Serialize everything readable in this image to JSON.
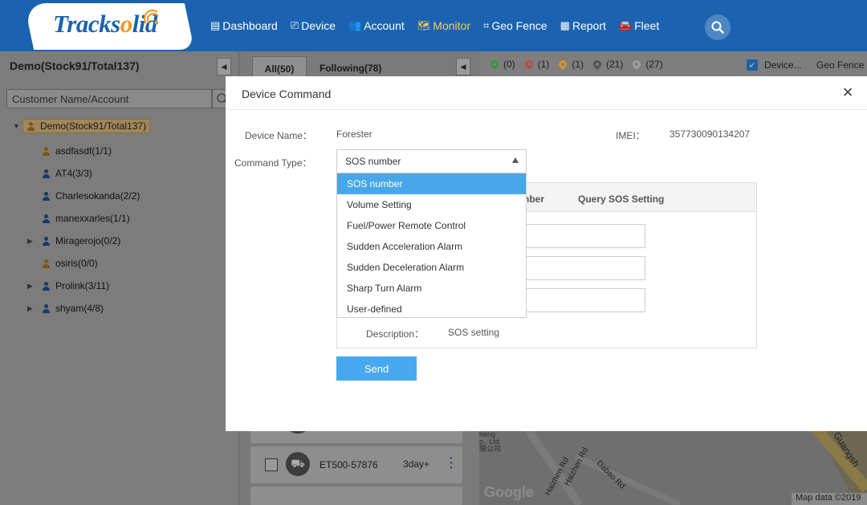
{
  "header": {
    "logo": "Tracksolid",
    "nav": [
      {
        "label": "Dashboard",
        "icon": "dashboard-icon",
        "glyph": "▤"
      },
      {
        "label": "Device",
        "icon": "device-icon",
        "glyph": "⎚"
      },
      {
        "label": "Account",
        "icon": "account-icon",
        "glyph": "👥"
      },
      {
        "label": "Monitor",
        "icon": "monitor-map-icon",
        "glyph": "🗺"
      },
      {
        "label": "Geo Fence",
        "icon": "geofence-icon",
        "glyph": "⌗"
      },
      {
        "label": "Report",
        "icon": "report-icon",
        "glyph": "▦"
      },
      {
        "label": "Fleet",
        "icon": "fleet-car-icon",
        "glyph": "🚘"
      }
    ],
    "active_color": "#f4d046"
  },
  "left_panel": {
    "title": "Demo(Stock91/Total137)",
    "search_placeholder": "Customer Name/Account",
    "tree_root": "Demo(Stock91/Total137)",
    "tree": [
      {
        "label": "asdfasdf(1/1)",
        "icon": "user-orange-icon",
        "expandable": false
      },
      {
        "label": "AT4(3/3)",
        "icon": "user-blue-icon",
        "expandable": false
      },
      {
        "label": "Charlesokanda(2/2)",
        "icon": "user-blue-icon",
        "expandable": false
      },
      {
        "label": "manexxarles(1/1)",
        "icon": "user-blue-icon",
        "expandable": false
      },
      {
        "label": "Miragerojo(0/2)",
        "icon": "user-blue-icon",
        "expandable": true
      },
      {
        "label": "osiris(0/0)",
        "icon": "user-orange-icon",
        "expandable": false
      },
      {
        "label": "Prolink(3/11)",
        "icon": "user-blue-icon",
        "expandable": true
      },
      {
        "label": "shyam(4/8)",
        "icon": "user-blue-icon",
        "expandable": true
      }
    ]
  },
  "mid_panel": {
    "tab_all": "All(50)",
    "tab_following": "Following(78)",
    "device_name": "ET500-57876",
    "device_time": "3day+"
  },
  "map": {
    "stats": [
      {
        "count": "(0)",
        "color": "#1fa02a"
      },
      {
        "count": "(1)",
        "color": "#d93a2f"
      },
      {
        "count": "(1)",
        "color": "#f09a1a"
      },
      {
        "count": "(21)",
        "color": "#444444"
      },
      {
        "count": "(27)",
        "color": "#aaaaaa"
      }
    ],
    "device_toggle": "Device...",
    "geo_fence": "Geo Fence",
    "labels": {
      "street1": "Haizhen Rd",
      "street2": "Haizhen Rd",
      "street3": "Dabao Rd",
      "area": "Guangsh",
      "company": "heng\no., Ltd.\n限公司"
    },
    "attribution": "Map data ©2019",
    "google": "Google"
  },
  "modal": {
    "title": "Device Command",
    "device_name_label": "Device Name：",
    "device_name": "Forester",
    "imei_label": "IMEI：",
    "imei": "357730090134207",
    "command_type_label": "Command Type：",
    "command_type": "SOS number",
    "options": [
      "SOS number",
      "Volume Setting",
      "Fuel/Power Remote Control",
      "Sudden Acceleration Alarm",
      "Sudden Deceleration Alarm",
      "Sharp Turn Alarm",
      "User-defined"
    ],
    "selected_index": 0,
    "tab_partial": "nber",
    "tab_query": "Query SOS Setting",
    "description_label": "Description：",
    "description": "SOS setting",
    "send": "Send"
  }
}
